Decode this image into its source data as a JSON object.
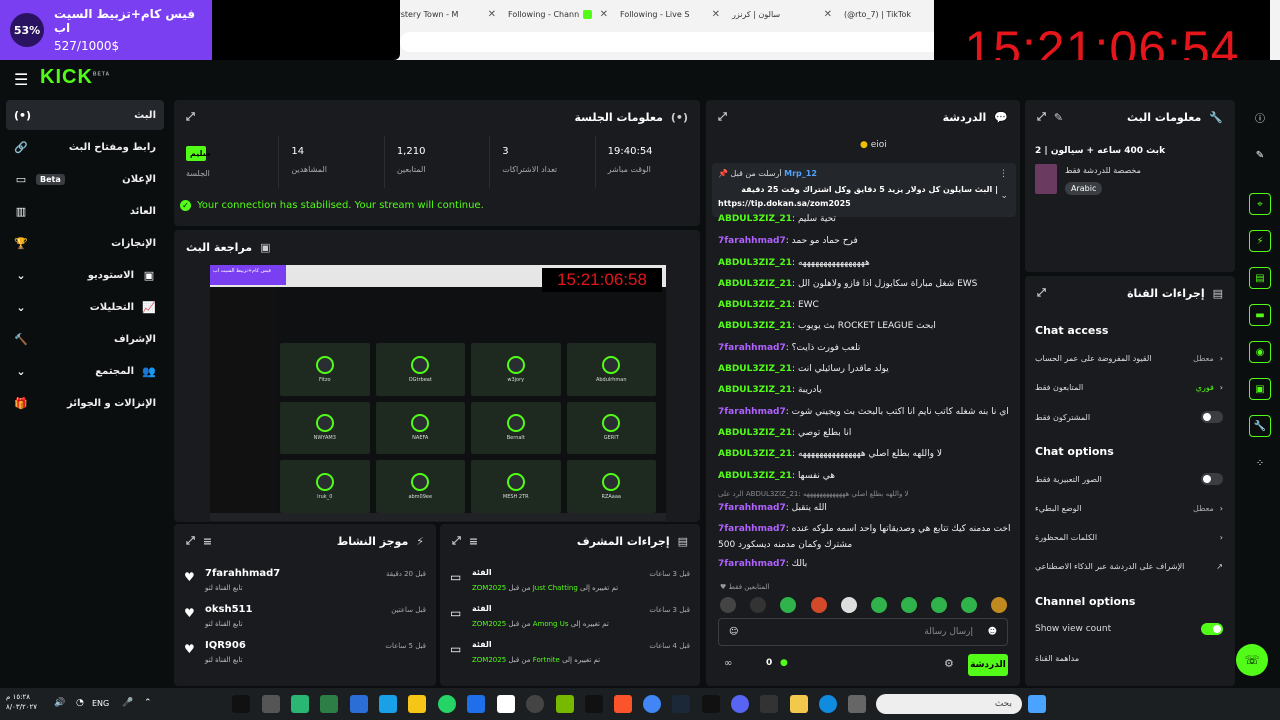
{
  "browser": {
    "tabs": [
      "ystery Town - M",
      "Following - Chann",
      "Following - Live S",
      "سالون | كرنزر",
      "(@rto_7) | TikTok"
    ]
  },
  "promo": {
    "percent": "53%",
    "title": "فيس كام+تزبيط السيت اب",
    "amount": "527/1000$"
  },
  "clock": "15:21:06:54",
  "sidebar": {
    "items": [
      {
        "label": "البث",
        "icon": "(•)"
      },
      {
        "label": "رابط ومفتاح البث",
        "icon": "🔗"
      },
      {
        "label": "الإعلان",
        "icon": "▭",
        "badge": "Beta"
      },
      {
        "label": "العائد",
        "icon": "▥"
      },
      {
        "label": "الإنجازات",
        "icon": "🏆"
      },
      {
        "label": "الاستوديو",
        "icon": "▣"
      },
      {
        "label": "التحليلات",
        "icon": "📈"
      },
      {
        "label": "الإشراف",
        "icon": "🔨"
      },
      {
        "label": "المجتمع",
        "icon": "👥"
      },
      {
        "label": "الإنزالات و الجوائز",
        "icon": "🎁"
      }
    ]
  },
  "session": {
    "title": "معلومات الجلسة",
    "stats": [
      {
        "value": "سليم",
        "label": "الجلسة"
      },
      {
        "value": "14",
        "label": "المشاهدين"
      },
      {
        "value": "1,210",
        "label": "المتابعين"
      },
      {
        "value": "3",
        "label": "تعداد الاشتراكات"
      },
      {
        "value": "19:40:54",
        "label": "الوقت مباشر"
      }
    ],
    "connection": "Your connection has stabilised. Your stream will continue."
  },
  "preview": {
    "title": "مراجعة البث",
    "clock": "15:21:06:58",
    "cells": [
      "Fitzo",
      "OGtrbeat",
      "w3jory",
      "Abdulrhman",
      "NWYAM3",
      "NAEFA",
      "Bernalt",
      "GERIT",
      "Iruk_0",
      "abm09ee",
      "MESH 2TR",
      "RZAaaa"
    ]
  },
  "activity": {
    "title": "موجز النشاط",
    "items": [
      {
        "name": "7farahhmad7",
        "sub": "تابع القناة لتو",
        "time": "قبل 20 دقيقة"
      },
      {
        "name": "oksh511",
        "sub": "تابع القناة لتو",
        "time": "قبل ساعتين"
      },
      {
        "name": "IQR906",
        "sub": "تابع القناة لتو",
        "time": "قبل 5 ساعات"
      }
    ]
  },
  "modactions": {
    "title": "إجراءات المشرف",
    "items": [
      {
        "title": "الفئة",
        "user": "ZOM2025",
        "mid": "من قبل",
        "game": "Just Chatting",
        "tail": "تم تغييره إلى",
        "time": "قبل 3 ساعات"
      },
      {
        "title": "الفئة",
        "user": "ZOM2025",
        "mid": "من قبل",
        "game": "Among Us",
        "tail": "تم تغييره إلى",
        "time": "قبل 3 ساعات"
      },
      {
        "title": "الفئة",
        "user": "ZOM2025",
        "mid": "من قبل",
        "game": "Fortnite",
        "tail": "تم تغييره إلى",
        "time": "قبل 4 ساعات"
      }
    ]
  },
  "chat": {
    "title": "الدردشة",
    "top_user": "eioi",
    "pinned": {
      "by": "أرسلت من قبل",
      "user": "Mrp_12",
      "text": "البث سايلون كل دولار يزيد 5 دقايق وكل اشتراك وقت 25 دقيقة |",
      "link": "https://tip.dokan.sa/zom2025"
    },
    "messages": [
      {
        "u": "ABDUL3ZIZ_21",
        "c": "g",
        "t": "تحية سليم"
      },
      {
        "u": "7farahhmad7",
        "c": "p",
        "t": "فرح حماد مو حمد"
      },
      {
        "u": "ABDUL3ZIZ_21",
        "c": "g",
        "t": "ههههههههههههههههه"
      },
      {
        "u": "ABDUL3ZIZ_21",
        "c": "g",
        "t": "شغل مباراة سكايوزل اذا فازو ولاهلون الل EWS"
      },
      {
        "u": "ABDUL3ZIZ_21",
        "c": "g",
        "t": "EWC"
      },
      {
        "u": "ABDUL3ZIZ_21",
        "c": "g",
        "t": "بث يويوب ROCKET LEAGUE ابحث"
      },
      {
        "u": "7farahhmad7",
        "c": "p",
        "t": "تلعب فورت ذايت؟"
      },
      {
        "u": "ABDUL3ZIZ_21",
        "c": "g",
        "t": "يولد ماقدرا رسائيلي انت"
      },
      {
        "u": "ABDUL3ZIZ_21",
        "c": "g",
        "t": "يادريبة"
      },
      {
        "u": "7farahhmad7",
        "c": "p",
        "t": "اي نا بنه شغله كاتب نايم انا اكتب بالبحث بث ويجيني شوت"
      },
      {
        "u": "ABDUL3ZIZ_21",
        "c": "g",
        "t": "انا بطلع توصي"
      },
      {
        "u": "ABDUL3ZIZ_21",
        "c": "g",
        "t": "لا واللهه بطلع اصلي هههههههههههههههه"
      },
      {
        "u": "ABDUL3ZIZ_21",
        "c": "g",
        "t": "هي نفسها"
      },
      {
        "u": "",
        "c": "",
        "t": "الرد على ABDUL3ZIZ_21: لا واللهه بطلع اصلي هههههههههههههه"
      },
      {
        "u": "7farahhmad7",
        "c": "p",
        "t": "الله يتقبل"
      },
      {
        "u": "7farahhmad7",
        "c": "p",
        "t": "عندي اخت مدمنه كيك تتابع هي وصديقاتها واحد اسمه ملوكه عنده"
      },
      {
        "u": "",
        "c": "",
        "t": "500 مشترك وكمان مدمنه ديسكورد"
      },
      {
        "u": "7farahhmad7",
        "c": "p",
        "t": "بالك"
      }
    ],
    "followers_only": "المتابعين فقط",
    "input_placeholder": "إرسال رسالة",
    "send": "الدردشة",
    "count": "0"
  },
  "streaminfo": {
    "title": "معلومات البث",
    "stream_title": "بث 400 ساعه + سيالون | 2k",
    "category": "مخصصة للدردشة فقط",
    "lang": "Arabic"
  },
  "channel": {
    "title": "إجراءات القناة",
    "access_title": "Chat access",
    "access": [
      {
        "l": "القيود المفروضة على عمر الحساب",
        "r": "معطل",
        "c": ""
      },
      {
        "l": "المتابعون فقط",
        "r": "فوري",
        "c": "g"
      },
      {
        "l": "المشتركون فقط",
        "r": "",
        "c": ""
      }
    ],
    "options_title": "Chat options",
    "options": [
      {
        "l": "الصور التعبيرية فقط",
        "r": ""
      },
      {
        "l": "الوضع البطيء",
        "r": "معطل"
      },
      {
        "l": "الكلمات المحظورة",
        "r": ""
      },
      {
        "l": "الإشراف على الدردشة عبر الذكاء الاصطناعي",
        "r": ""
      }
    ],
    "channel_title": "Channel options",
    "show_view_count": "Show view count",
    "raid": "مداهمة القناة"
  },
  "taskbar": {
    "lang": "ENG",
    "time": "١٥:٢٨ م",
    "date": "٨/٠٣/٢٠٢٧",
    "search": "بحث"
  }
}
